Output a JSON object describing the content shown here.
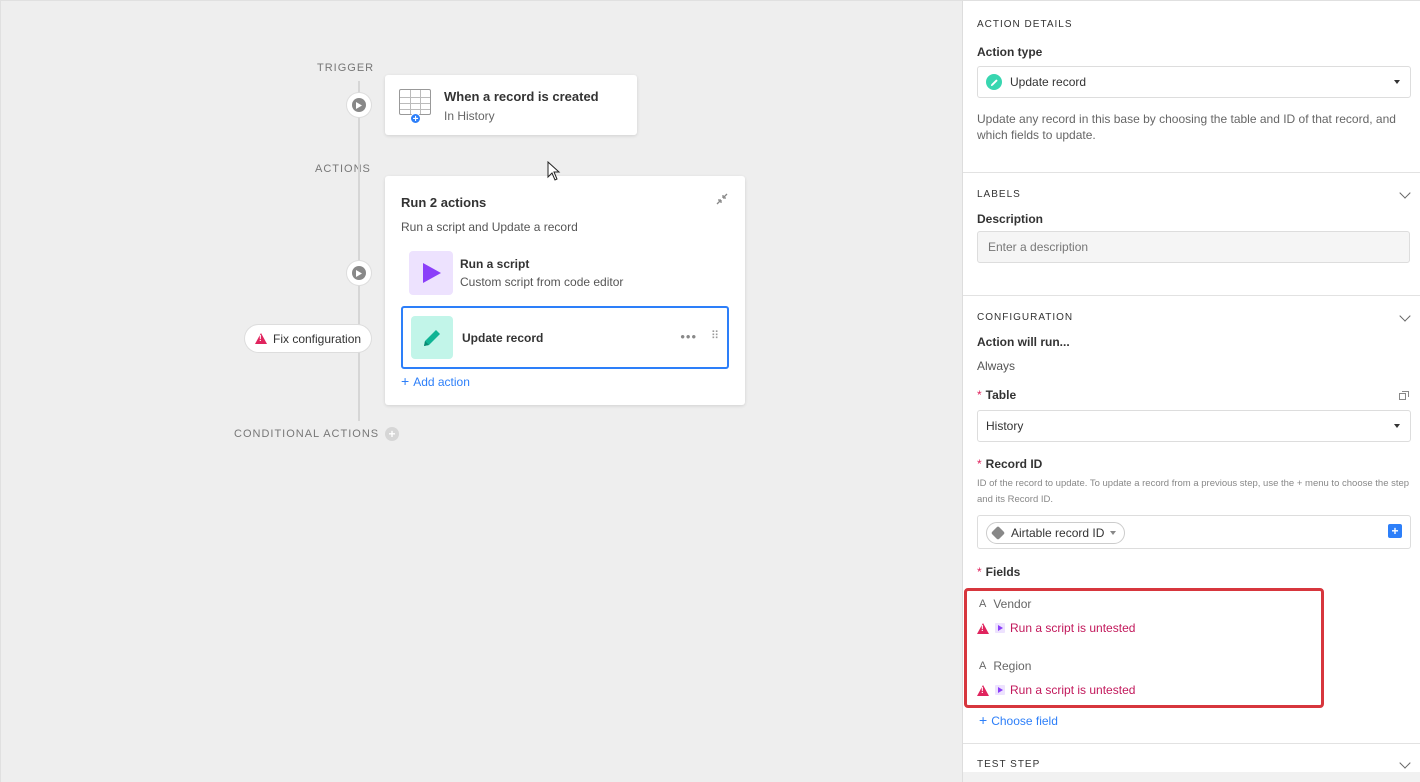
{
  "canvas": {
    "trigger_label": "TRIGGER",
    "actions_label": "ACTIONS",
    "conditional_label": "CONDITIONAL ACTIONS",
    "trigger_card": {
      "title": "When a record is created",
      "subtitle": "In History"
    },
    "actions_card": {
      "title": "Run 2 actions",
      "subtitle": "Run a script and Update a record",
      "steps": [
        {
          "title": "Run a script",
          "subtitle": "Custom script from code editor"
        },
        {
          "title": "Update record",
          "subtitle": ""
        }
      ],
      "add_action": "Add action"
    },
    "fix_config": "Fix configuration"
  },
  "panel": {
    "action_details_caption": "ACTION DETAILS",
    "action_type_label": "Action type",
    "action_type_value": "Update record",
    "action_type_desc": "Update any record in this base by choosing the table and ID of that record, and which fields to update.",
    "labels_caption": "LABELS",
    "description_label": "Description",
    "description_placeholder": "Enter a description",
    "configuration_caption": "CONFIGURATION",
    "run_label": "Action will run...",
    "run_value": "Always",
    "table_label": "Table",
    "table_value": "History",
    "record_id_label": "Record ID",
    "record_id_help": "ID of the record to update. To update a record from a previous step, use the + menu to choose the step and its Record ID.",
    "record_id_token": "Airtable record ID",
    "fields_label": "Fields",
    "fields": [
      {
        "name": "Vendor",
        "warn_step": "Run a script",
        "warn_text": "is untested"
      },
      {
        "name": "Region",
        "warn_step": "Run a script",
        "warn_text": "is untested"
      }
    ],
    "choose_field": "Choose field",
    "test_step_caption": "TEST STEP"
  },
  "colors": {
    "accent": "#2d7ff9",
    "warning": "#e0245e",
    "highlight": "#d7363d",
    "script_bg": "#ede2fe",
    "script_icon": "#8b3ff9",
    "update_bg": "#c2f5e9",
    "update_icon": "#0fb494"
  }
}
